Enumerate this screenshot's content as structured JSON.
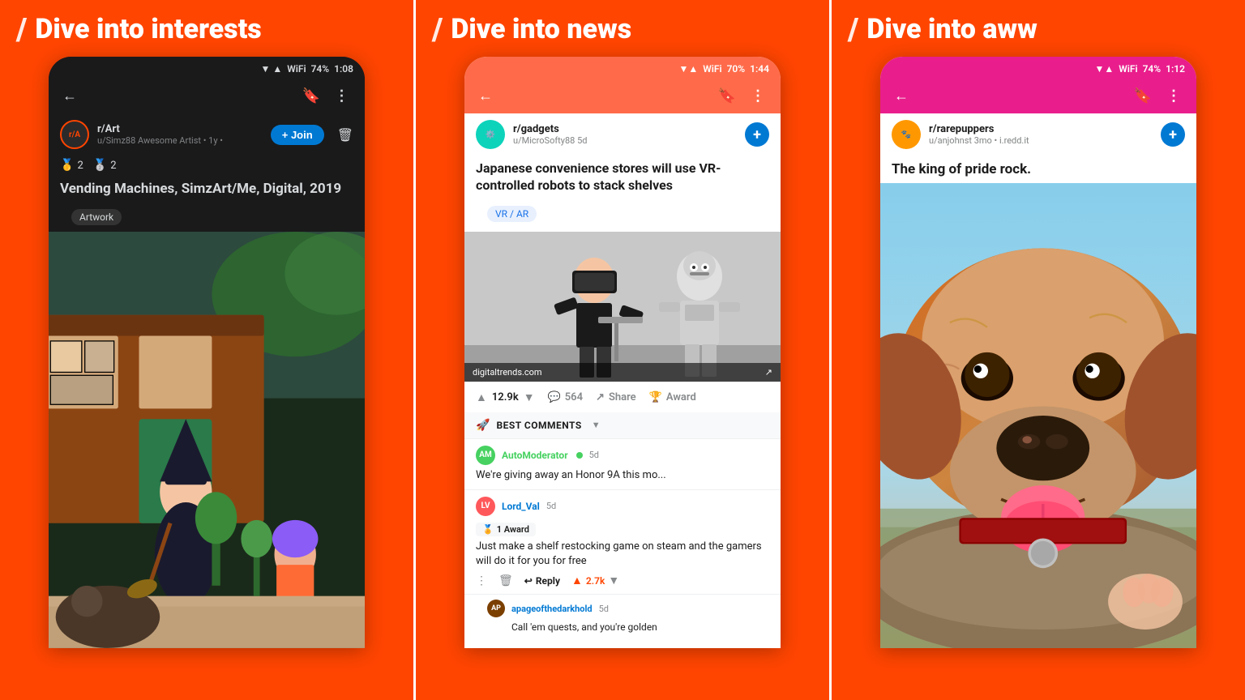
{
  "panels": [
    {
      "id": "interests",
      "slash": "/",
      "title": "Dive into interests",
      "bg_color": "#FF4500",
      "phone_theme": "dark",
      "status": {
        "battery": "74%",
        "time": "1:08"
      },
      "subreddit": "r/Art",
      "posted_by": "u/Simz88",
      "posted_meta": "Awesome Artist • 1y •",
      "join_label": "+ Join",
      "awards": [
        "2",
        "2"
      ],
      "post_title": "Vending Machines, SimzArt/Me, Digital, 2019",
      "flair": "Artwork"
    },
    {
      "id": "news",
      "slash": "/",
      "title": "Dive into news",
      "bg_color": "#FF4500",
      "phone_theme": "light",
      "status": {
        "battery": "70%",
        "time": "1:44"
      },
      "subreddit": "r/gadgets",
      "posted_by": "u/MicroSofty88",
      "posted_meta": "5d",
      "post_title": "Japanese convenience stores will use VR-controlled robots to stack shelves",
      "flair": "VR / AR",
      "image_source": "digitaltrends.com",
      "votes": "12.9k",
      "comments": "564",
      "share_label": "Share",
      "award_label": "Award",
      "best_comments_label": "BEST COMMENTS",
      "comments_list": [
        {
          "user": "AutoModerator",
          "user_color": "automoderator",
          "meta": "5d",
          "text": "We're giving away an Honor 9A this mo...",
          "has_green_dot": true
        },
        {
          "user": "Lord_Val",
          "meta": "5d",
          "award": "1 Award",
          "text": "Just make a shelf restocking game on steam and the gamers will do it for you for free",
          "upvotes": "2.7k"
        }
      ],
      "nested_comment": {
        "user": "apageofthedarkhold",
        "meta": "5d",
        "text": "Call 'em quests, and you're golden"
      },
      "reply_label": "Reply"
    },
    {
      "id": "aww",
      "slash": "/",
      "title": "Dive into aww",
      "bg_color": "#FF4500",
      "phone_theme": "pink",
      "status": {
        "battery": "74%",
        "time": "1:12"
      },
      "subreddit": "r/rarepuppers",
      "posted_by": "u/anjohnst",
      "posted_meta": "3mo • i.redd.it",
      "post_title": "The king of pride rock."
    }
  ],
  "icons": {
    "back_arrow": "←",
    "bookmark": "🔖",
    "more": "⋮",
    "upvote": "▲",
    "downvote": "▼",
    "comment": "💬",
    "share": "↗",
    "award": "🏆",
    "rocket": "🚀",
    "reply_arrow": "↩",
    "medal": "🏅"
  }
}
